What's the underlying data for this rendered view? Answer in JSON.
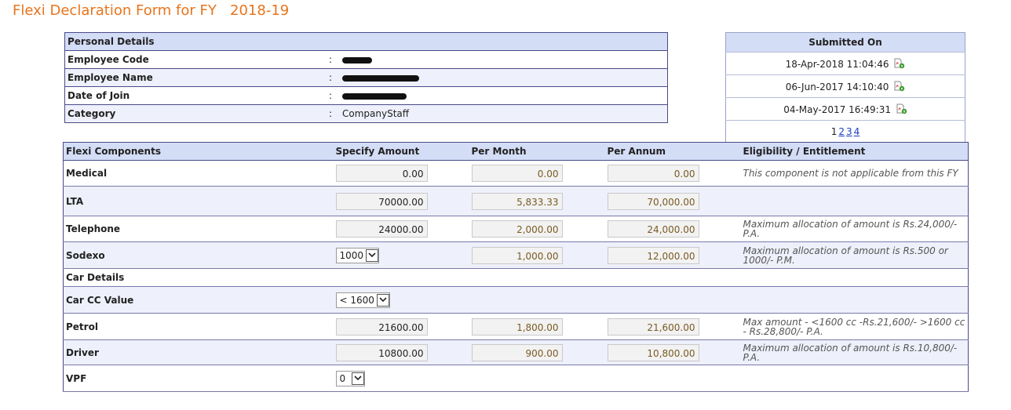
{
  "page": {
    "title": "Flexi Declaration Form for FY   2018-19"
  },
  "personal": {
    "header": "Personal Details",
    "rows": [
      {
        "label": "Employee Code",
        "colon": ":",
        "value": "",
        "redacted": true
      },
      {
        "label": "Employee Name",
        "colon": ":",
        "value": "",
        "redacted": true
      },
      {
        "label": "Date of Join",
        "colon": ":",
        "value": "",
        "redacted": true
      },
      {
        "label": "Category",
        "colon": ":",
        "value": "CompanyStaff",
        "redacted": false
      }
    ]
  },
  "submitted": {
    "header": "Submitted On",
    "entries": [
      "18-Apr-2018 11:04:46",
      "06-Jun-2017 14:10:40",
      "04-May-2017 16:49:31"
    ],
    "pages": [
      "1",
      "2",
      "3",
      "4"
    ],
    "current_page": "1"
  },
  "flexi": {
    "headers": [
      "Flexi Components",
      "Specify Amount",
      "Per Month",
      "Per Annum",
      "Eligibility / Entitlement"
    ],
    "medical": {
      "name": "Medical",
      "amount": "0.00",
      "per_month": "0.00",
      "per_annum": "0.00",
      "eligibility": "This component is not applicable from this FY"
    },
    "lta": {
      "name": "LTA",
      "amount": "70000.00",
      "per_month": "5,833.33",
      "per_annum": "70,000.00",
      "eligibility": ""
    },
    "telephone": {
      "name": "Telephone",
      "amount": "24000.00",
      "per_month": "2,000.00",
      "per_annum": "24,000.00",
      "eligibility": "Maximum allocation of amount is Rs.24,000/- P.A."
    },
    "sodexo": {
      "name": "Sodexo",
      "selected": "1000",
      "per_month": "1,000.00",
      "per_annum": "12,000.00",
      "eligibility": "Maximum allocation of amount is Rs.500 or 1000/- P.M."
    },
    "car_details": {
      "name": "Car Details"
    },
    "car_cc": {
      "name": "Car CC Value",
      "selected": "< 1600"
    },
    "petrol": {
      "name": "Petrol",
      "amount": "21600.00",
      "per_month": "1,800.00",
      "per_annum": "21,600.00",
      "eligibility": "Max amount - <1600 cc -Rs.21,600/- >1600 cc - Rs.28,800/- P.A."
    },
    "driver": {
      "name": "Driver",
      "amount": "10800.00",
      "per_month": "900.00",
      "per_annum": "10,800.00",
      "eligibility": "Maximum allocation of amount is Rs.10,800/- P.A."
    },
    "vpf": {
      "name": "VPF",
      "selected": "0"
    }
  },
  "colors": {
    "title": "#e8741c",
    "header_bg": "#d4ddf6",
    "row_alt_bg": "#eef0fb",
    "link": "#1a3fbf"
  },
  "icons": {
    "pdf": "pdf-file-icon",
    "dropdown": "chevron-down-icon"
  }
}
